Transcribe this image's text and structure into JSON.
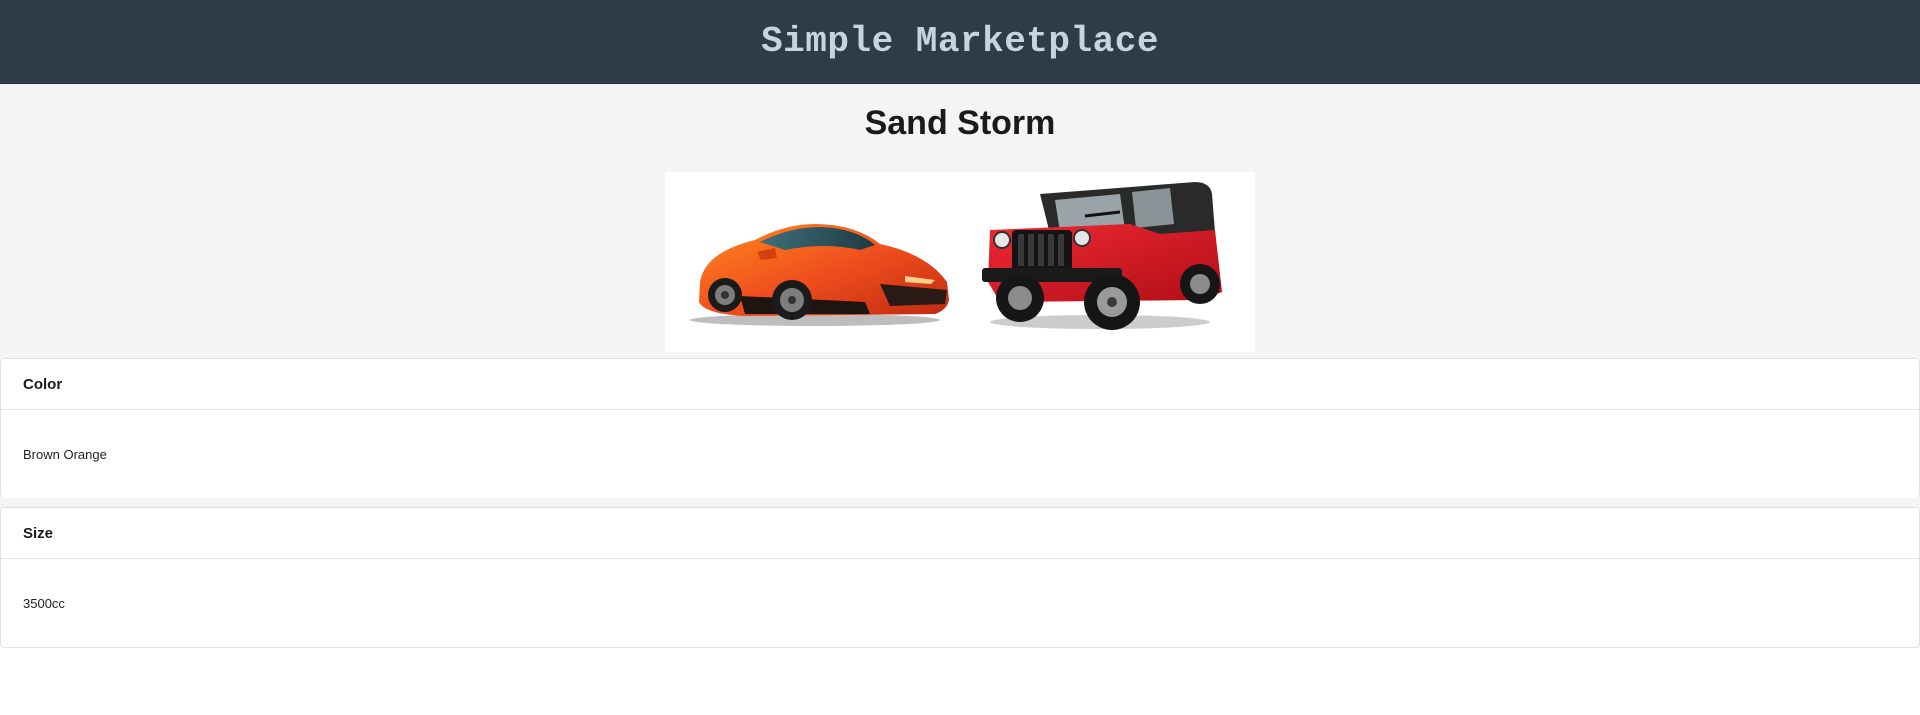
{
  "header": {
    "site_title": "Simple Marketplace",
    "background_color": "#2f3b45",
    "title_color": "#c7d3dd"
  },
  "product": {
    "title": "Sand Storm",
    "images": [
      {
        "name": "orange-sports-car-image",
        "body_color": "#f0501e"
      },
      {
        "name": "red-jeep-image",
        "body_color": "#d8121f"
      }
    ]
  },
  "attributes": [
    {
      "label": "Color",
      "value": "Brown Orange"
    },
    {
      "label": "Size",
      "value": "3500cc"
    }
  ]
}
